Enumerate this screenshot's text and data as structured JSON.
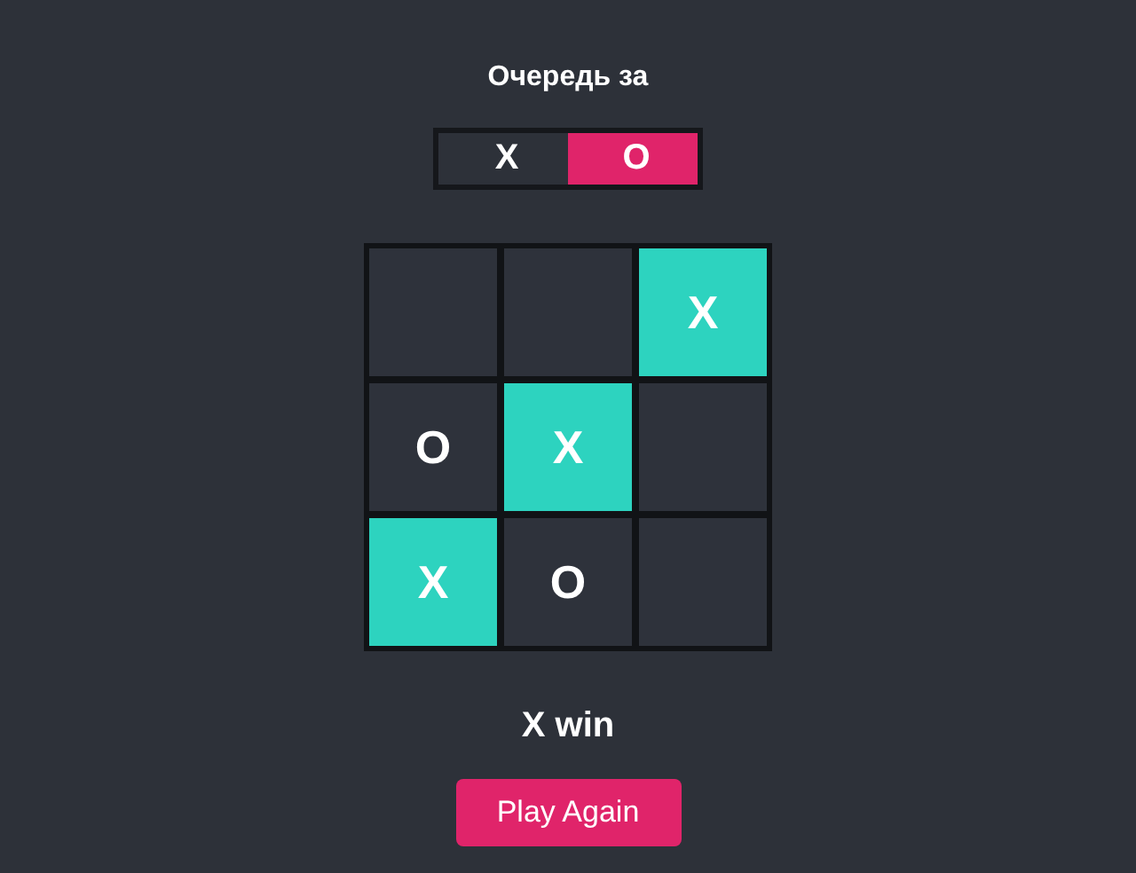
{
  "title": "Очередь за",
  "turn": [
    {
      "label": "X",
      "selected": false
    },
    {
      "label": "O",
      "selected": true
    }
  ],
  "board": [
    {
      "highlighted": false
    },
    {
      "highlighted": false
    },
    {
      "mark": "X",
      "highlighted": true
    },
    {
      "mark": "O",
      "highlighted": false
    },
    {
      "mark": "X",
      "highlighted": true
    },
    {
      "highlighted": false
    },
    {
      "mark": "X",
      "highlighted": true
    },
    {
      "mark": "O",
      "highlighted": false
    },
    {
      "highlighted": false
    }
  ],
  "status": "X win",
  "button": "Play Again"
}
